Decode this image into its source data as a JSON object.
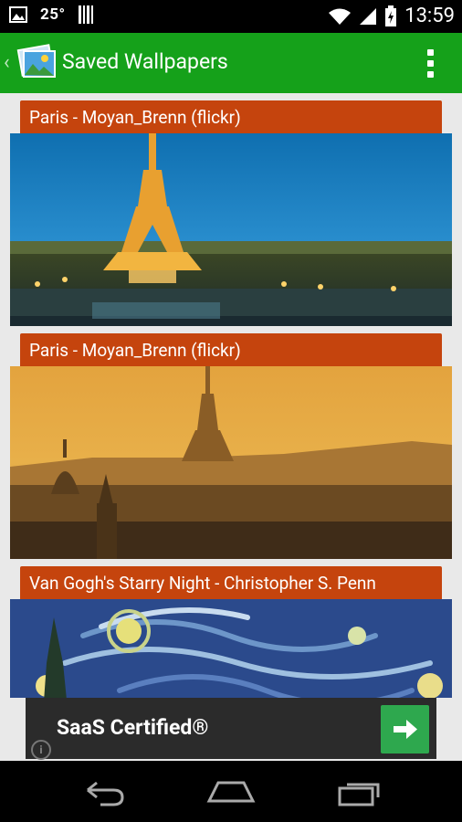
{
  "status_bar": {
    "temperature": "25°",
    "time": "13:59"
  },
  "action_bar": {
    "title": "Saved Wallpapers"
  },
  "wallpapers": [
    {
      "title": "Paris - Moyan_Brenn (flickr)"
    },
    {
      "title": "Paris - Moyan_Brenn (flickr)"
    },
    {
      "title": "Van Gogh's Starry Night - Christopher S. Penn"
    }
  ],
  "ad": {
    "headline": "SaaS Certified®",
    "info_label": "i"
  },
  "colors": {
    "action_bar": "#15a11a",
    "card_header": "#c5440d",
    "ad_button": "#2ea84e"
  }
}
